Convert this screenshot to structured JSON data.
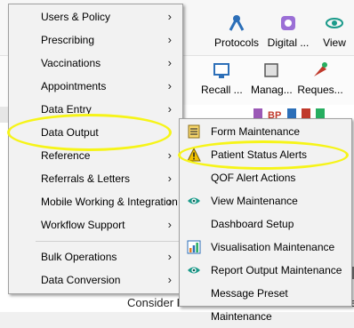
{
  "ribbon": {
    "buttons": [
      {
        "label": "Protocols",
        "icon": "protocols-icon"
      },
      {
        "label": "Digital ...",
        "icon": "digital-icon"
      },
      {
        "label": "View",
        "icon": "eye-icon"
      }
    ],
    "row2_buttons": [
      {
        "label": "Recall ..."
      },
      {
        "label": "Manag..."
      },
      {
        "label": "Reques..."
      }
    ],
    "partial_label": "st"
  },
  "background_text": "Consider Pertussis vaccination* after 16 week",
  "main_menu": {
    "items": [
      {
        "label": "Users & Policy",
        "submenu": true
      },
      {
        "label": "Prescribing",
        "submenu": true
      },
      {
        "label": "Vaccinations",
        "submenu": true
      },
      {
        "label": "Appointments",
        "submenu": true
      },
      {
        "label": "Data Entry",
        "submenu": true
      },
      {
        "label": "Data Output",
        "submenu": false,
        "highlighted": true
      },
      {
        "label": "Reference",
        "submenu": true
      },
      {
        "label": "Referrals & Letters",
        "submenu": true
      },
      {
        "label": "Mobile Working & Integration",
        "submenu": true
      },
      {
        "label": "Workflow Support",
        "submenu": true
      },
      {
        "label": "Bulk Operations",
        "submenu": true
      },
      {
        "label": "Data Conversion",
        "submenu": true
      }
    ],
    "arrow_glyph": "›"
  },
  "sub_menu": {
    "items": [
      {
        "label": "Form Maintenance",
        "icon": "form-document-icon"
      },
      {
        "label": "Patient Status Alerts",
        "icon": "warning-icon",
        "highlighted": true
      },
      {
        "label": "QOF Alert Actions",
        "icon": ""
      },
      {
        "label": "View Maintenance",
        "icon": "eye-icon"
      },
      {
        "label": "Dashboard Setup",
        "icon": ""
      },
      {
        "label": "Visualisation Maintenance",
        "icon": "visualisation-icon"
      },
      {
        "label": "Report Output Maintenance",
        "icon": "eye-icon"
      },
      {
        "label": "Message Preset Maintenance",
        "icon": ""
      }
    ]
  },
  "colors": {
    "highlight": "#f6f418",
    "eye_icon": "#1a9a8a",
    "warning_icon": "#f2c200"
  }
}
